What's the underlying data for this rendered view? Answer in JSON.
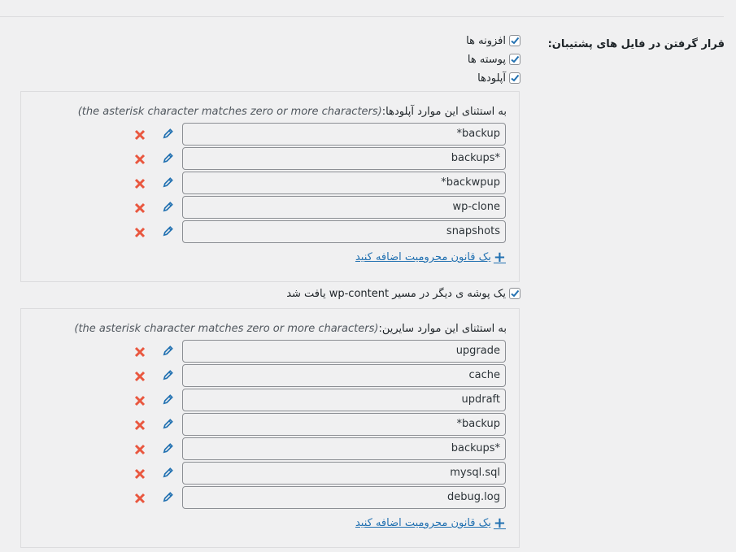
{
  "section_label": "قرار گرفتن در فایل های پشتیبان:",
  "checkboxes": [
    {
      "label": "افزونه ها",
      "checked": true
    },
    {
      "label": "پوسته ها",
      "checked": true
    },
    {
      "label": "آپلودها",
      "checked": true
    }
  ],
  "uploads_box": {
    "title": "به استثنای این موارد آپلودها:",
    "hint": "(the asterisk character matches zero or more characters)",
    "rules": [
      "*backup",
      "backups*",
      "*backwpup",
      "wp-clone",
      "snapshots"
    ],
    "add_label": "یک قانون محرومیت اضافه کنید"
  },
  "other_checkbox": {
    "label": "یک پوشه ی دیگر در مسیر wp-content یافت شد",
    "checked": true
  },
  "others_box": {
    "title": "به استثنای این موارد سایرین:",
    "hint": "(the asterisk character matches zero or more characters)",
    "rules": [
      "upgrade",
      "cache",
      "updraft",
      "*backup",
      "backups*",
      "mysql.sql",
      "debug.log"
    ],
    "add_label": "یک قانون محرومیت اضافه کنید"
  },
  "colors": {
    "accent": "#2271b1",
    "delete": "#e9573f",
    "edit": "#2271b1"
  }
}
